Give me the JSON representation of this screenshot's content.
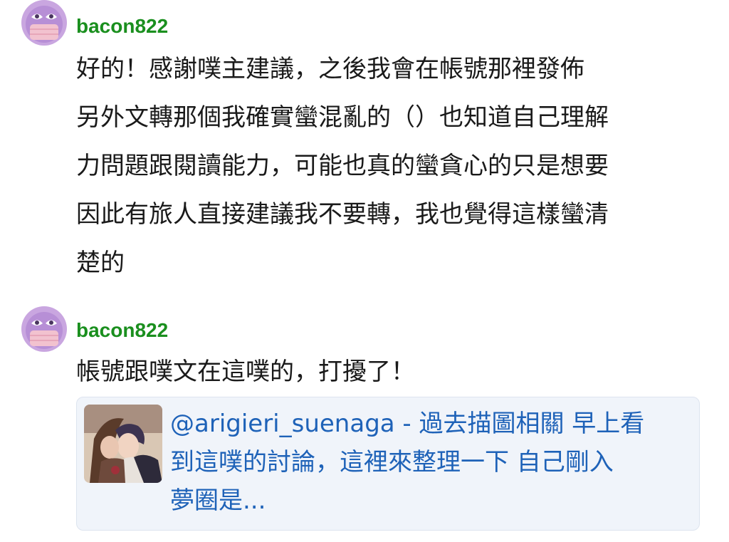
{
  "comments": [
    {
      "username": "bacon822",
      "avatar_icon": "masked-face-avatar-icon",
      "text": "好的！感謝噗主建議，之後我會在帳號那裡發佈\n另外文轉那個我確實蠻混亂的（）也知道自己理解\n力問題跟閱讀能力，可能也真的蠻貪心的只是想要\n因此有旅人直接建議我不要轉，我也覺得這樣蠻清\n楚的"
    },
    {
      "username": "bacon822",
      "avatar_icon": "masked-face-avatar-icon",
      "text": "帳號跟噗文在這噗的，打擾了！",
      "link_preview": {
        "thumbnail_icon": "illustration-thumbnail-icon",
        "text": "@arigieri_suenaga - 過去描圖相關 早上看\n到這噗的討論，這裡來整理一下 自己剛入\n夢圈是..."
      }
    }
  ],
  "colors": {
    "username": "#1a8f1e",
    "body_text": "#1a1a1a",
    "link_text": "#1e62b8",
    "card_background": "#f0f4fa",
    "avatar_face": "#c9a6e0",
    "avatar_mask": "#f2c2cf"
  }
}
